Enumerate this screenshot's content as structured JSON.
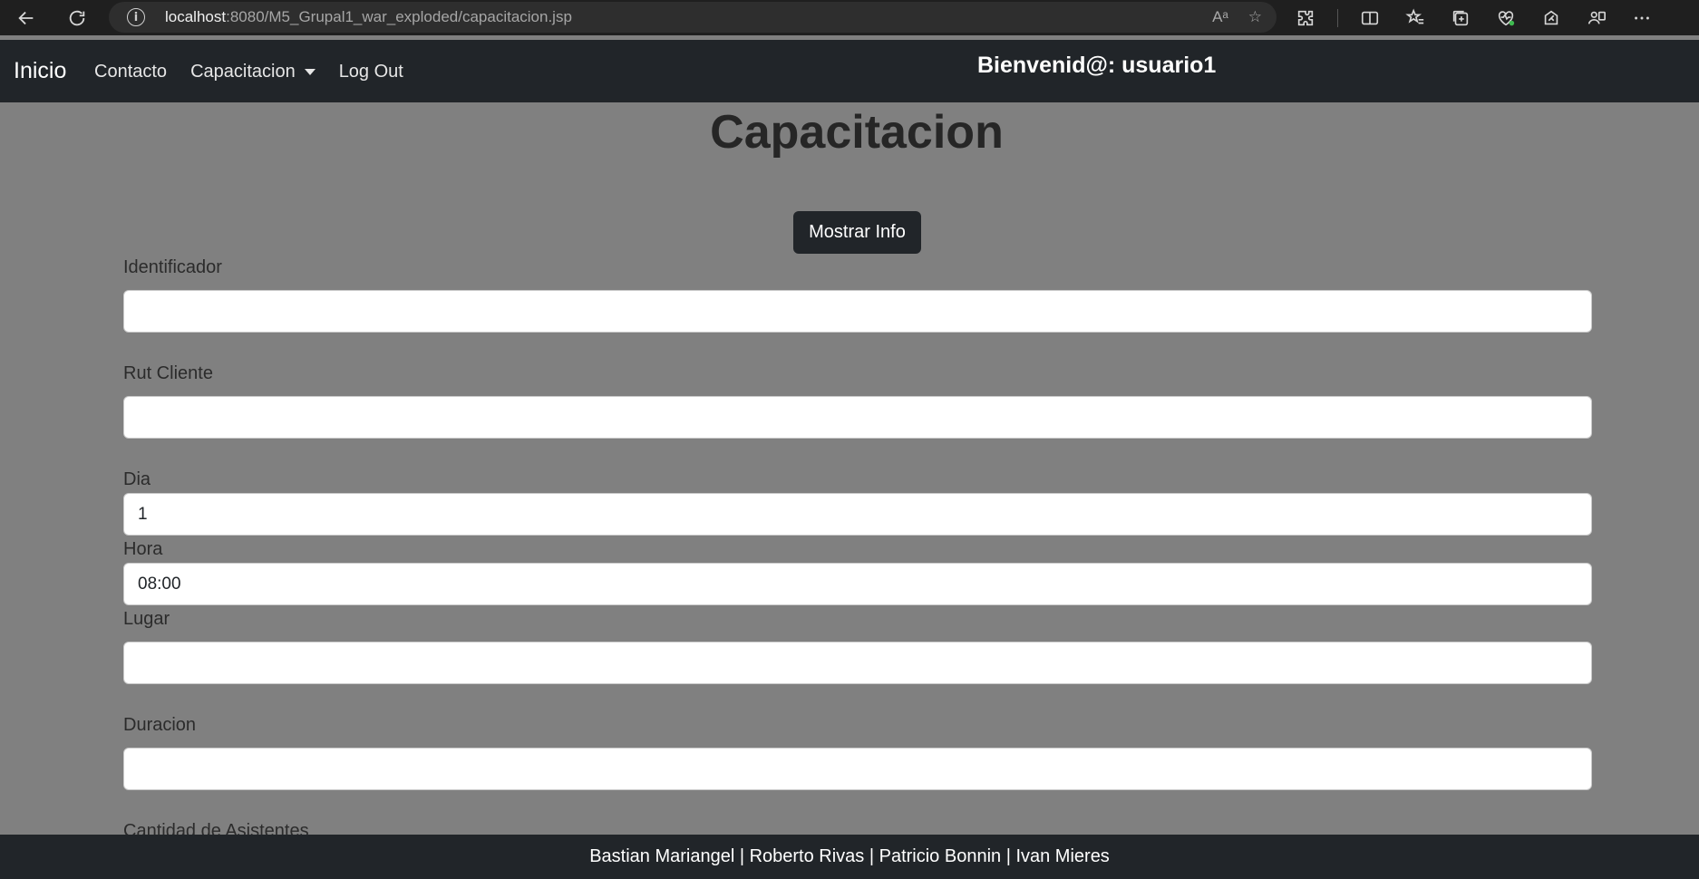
{
  "browser": {
    "url_host": "localhost",
    "url_path": ":8080/M5_Grupal1_war_exploded/capacitacion.jsp",
    "read_aloud_glyph": "Aᵃ"
  },
  "navbar": {
    "brand": "Inicio",
    "links": [
      "Contacto",
      "Capacitacion",
      "Log Out"
    ],
    "welcome": "Bienvenid@: usuario1"
  },
  "page": {
    "title": "Capacitacion",
    "info_button": "Mostrar Info"
  },
  "form": {
    "identificador": {
      "label": "Identificador",
      "value": ""
    },
    "rut_cliente": {
      "label": "Rut Cliente",
      "value": ""
    },
    "dia": {
      "label": "Dia",
      "value": "1"
    },
    "hora": {
      "label": "Hora",
      "value": "08:00"
    },
    "lugar": {
      "label": "Lugar",
      "value": ""
    },
    "duracion": {
      "label": "Duracion",
      "value": ""
    },
    "cantidad_asistentes": {
      "label": "Cantidad de Asistentes"
    }
  },
  "footer": {
    "text": "Bastian Mariangel | Roberto Rivas | Patricio Bonnin | Ivan Mieres"
  },
  "colors": {
    "navbar_bg": "#212529",
    "page_bg": "#808080",
    "browser_bg": "#1f1f1f"
  }
}
